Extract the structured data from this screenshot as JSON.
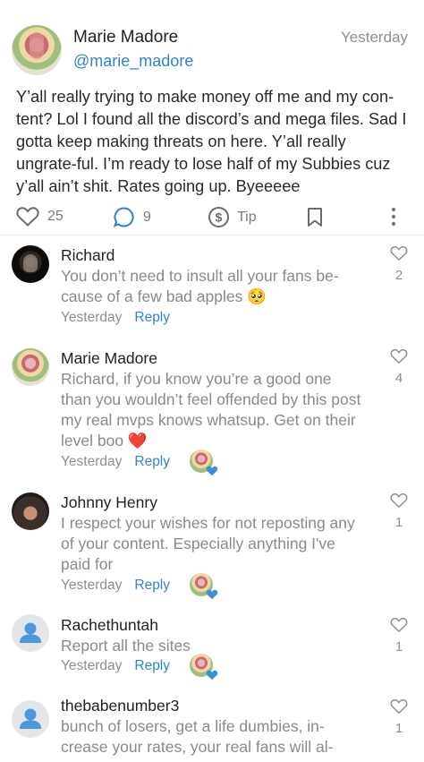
{
  "post": {
    "author_name": "Marie Madore",
    "author_handle": "@marie_madore",
    "time": "Yesterday",
    "text": "Y’all really trying to make money off me and my con-tent? Lol I found all the discord’s and mega files. Sad I gotta keep making threats on here. Y’all really ungrate-ful. I’m ready to lose half of my Subbies cuz y’all ain’t shit. Rates going up. Byeeeee",
    "likes": "25",
    "comments": "9",
    "tip_label": "Tip"
  },
  "comments": [
    {
      "name": "Richard",
      "text": "You don’t need to insult all your fans be-cause of a few bad apples 🥺",
      "time": "Yesterday",
      "reply_label": "Reply",
      "likes": "2"
    },
    {
      "name": "Marie Madore",
      "text": "Richard, if you know you’re a good one than you wouldn’t feel offended by this post my real mvps knows whatsup. Get on their level boo ❤️",
      "time": "Yesterday",
      "reply_label": "Reply",
      "likes": "4"
    },
    {
      "name": "Johnny Henry",
      "text": "I respect your wishes for not reposting any of your content. Especially anything I've paid for",
      "time": "Yesterday",
      "reply_label": "Reply",
      "likes": "1"
    },
    {
      "name": "Rachethuntah",
      "text": "Report all the sites",
      "time": "Yesterday",
      "reply_label": "Reply",
      "likes": "1"
    },
    {
      "name": "thebabenumber3",
      "text": "bunch of losers, get a life dumbies, in-crease your rates, your real fans will al-",
      "likes": "1"
    }
  ],
  "colors": {
    "accent": "#2f86c6",
    "muted": "#8e8e8e",
    "heart_blue": "#3b8fd6"
  }
}
